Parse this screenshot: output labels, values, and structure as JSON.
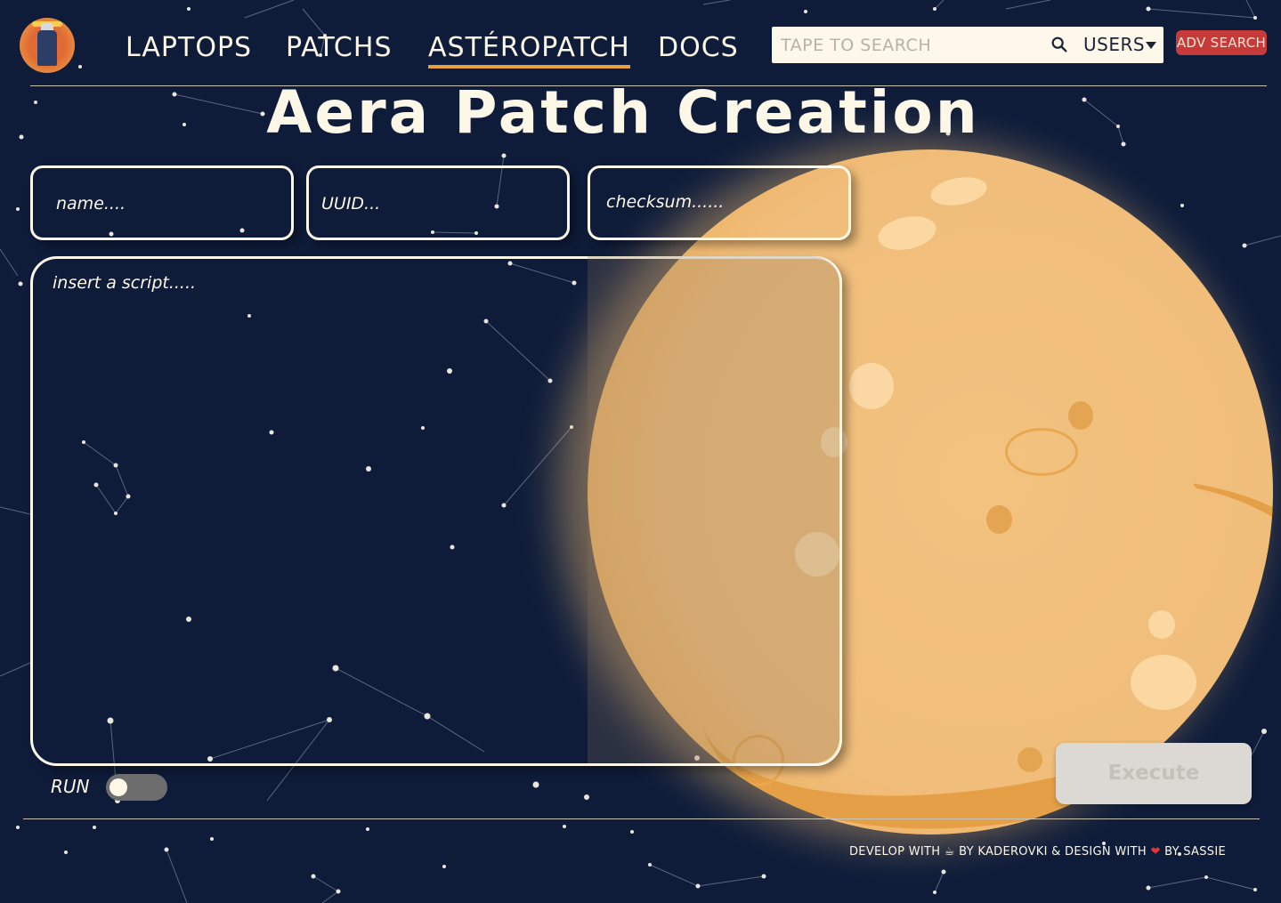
{
  "header": {
    "logo_icon": "robot-logo-icon",
    "nav": [
      {
        "label": "LAPTOPS"
      },
      {
        "label": "PATCHS"
      },
      {
        "label": "ASTÉROPATCH"
      },
      {
        "label": "DOCS"
      }
    ],
    "active_nav": "ASTÉROPATCH",
    "search": {
      "placeholder": "TAPE TO SEARCH",
      "value": ""
    },
    "search_icon": "search-icon",
    "users_select": {
      "selected": "USERS"
    },
    "adv_search_label": "ADV SEARCH"
  },
  "main": {
    "title": "Aera Patch Creation",
    "fields": {
      "name_placeholder": "name....",
      "uuid_placeholder": "UUID...",
      "checksum_placeholder": "checksum......",
      "script_placeholder": "insert a script....."
    },
    "run_label": "RUN",
    "run_toggle_on": false,
    "execute_label": "Execute"
  },
  "footer": {
    "part1": "DEVELOP WITH ",
    "part2": " BY  KADEROVKI & DESIGN WITH ",
    "part3": " BY SASSIE",
    "heart": "❤",
    "cup": "☕"
  },
  "colors": {
    "background": "#0e1c3a",
    "accent": "#e8a03c",
    "adv_search": "#c73a3a",
    "moon": "#f0bd7a"
  }
}
